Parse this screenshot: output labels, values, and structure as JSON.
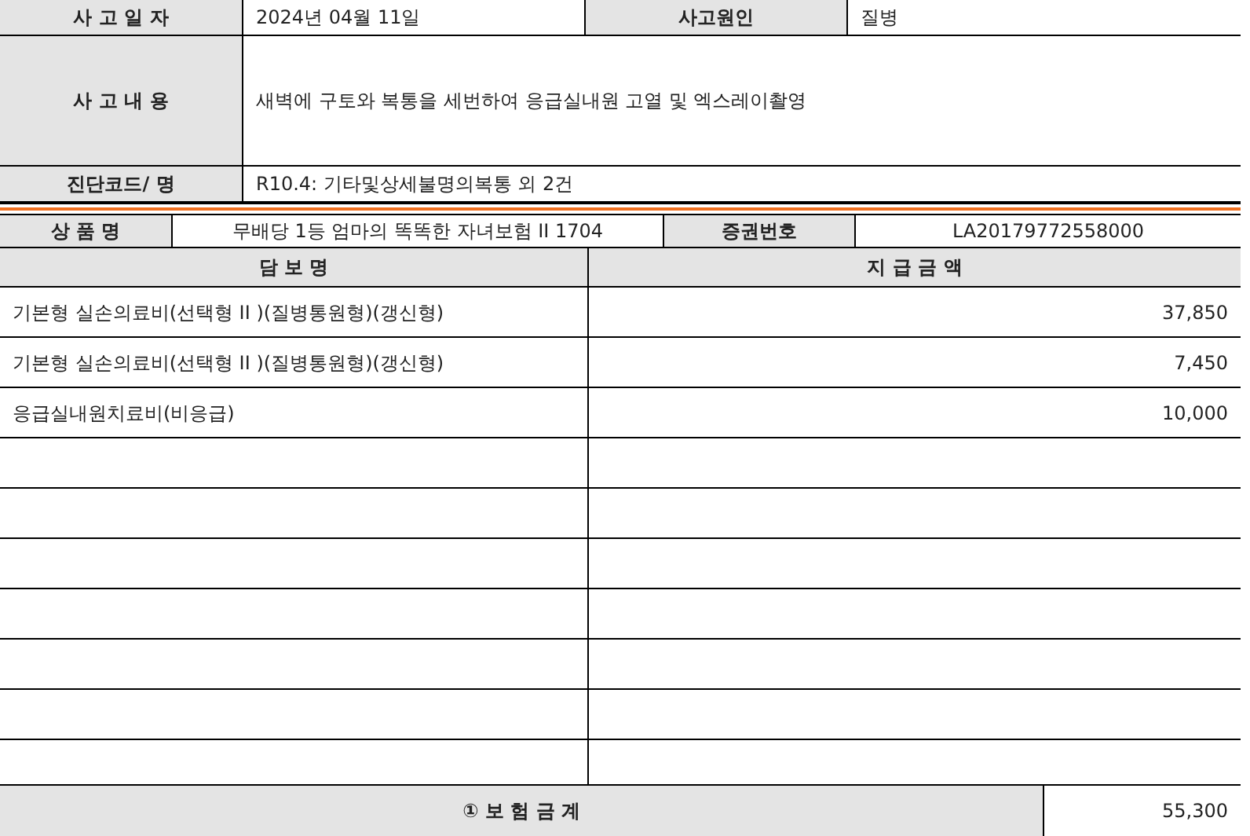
{
  "accident": {
    "date_label": "사 고 일 자",
    "date": "2024년 04월 11일",
    "cause_label": "사고원인",
    "cause": "질병",
    "details_label": "사 고 내 용",
    "details": "새벽에 구토와 복통을 세번하여 응급실내원 고열 및 엑스레이촬영",
    "diagnosis_label": "진단코드/ 명",
    "diagnosis": "R10.4: 기타및상세불명의복통 외 2건"
  },
  "product": {
    "name_label": "상 품 명",
    "name": "무배당 1등 엄마의 똑똑한 자녀보험 II 1704",
    "policy_label": "증권번호",
    "policy": "LA20179772558000"
  },
  "coverage": {
    "columns": [
      "담 보 명",
      "지 급 금 액"
    ],
    "rows": [
      {
        "name": "기본형 실손의료비(선택형 II )(질병통원형)(갱신형)",
        "amount": "37,850"
      },
      {
        "name": "기본형 실손의료비(선택형 II )(질병통원형)(갱신형)",
        "amount": "7,450"
      },
      {
        "name": "응급실내원치료비(비응급)",
        "amount": "10,000"
      }
    ]
  },
  "total": {
    "label": "① 보 험 금 계",
    "amount": "55,300"
  }
}
